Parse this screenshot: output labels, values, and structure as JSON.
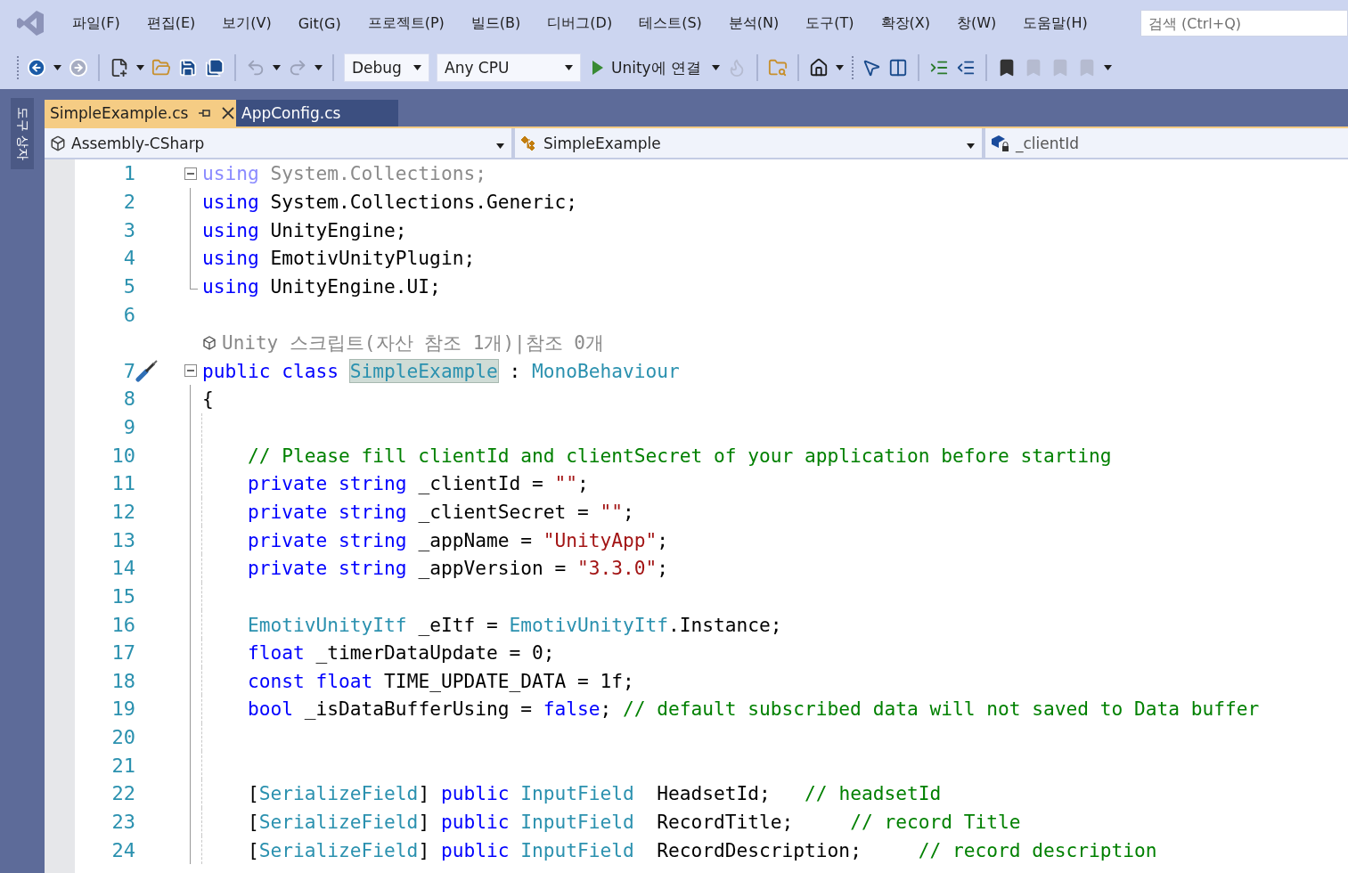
{
  "menu": {
    "items": [
      "파일(F)",
      "편집(E)",
      "보기(V)",
      "Git(G)",
      "프로젝트(P)",
      "빌드(B)",
      "디버그(D)",
      "테스트(S)",
      "분석(N)",
      "도구(T)",
      "확장(X)",
      "창(W)",
      "도움말(H)"
    ],
    "search": {
      "placeholder": "검색 (Ctrl+Q)"
    }
  },
  "toolbar": {
    "configuration": "Debug",
    "platform": "Any CPU",
    "run": "Unity에 연결"
  },
  "side_strip": {
    "label": "도구 상자"
  },
  "tabs": [
    {
      "label": "SimpleExample.cs",
      "selected": true
    },
    {
      "label": "AppConfig.cs",
      "selected": false
    }
  ],
  "nav_bar": {
    "project": "Assembly-CSharp",
    "type": "SimpleExample",
    "member": "_clientId"
  },
  "code": [
    {
      "kind": "code",
      "number": "1",
      "expanded": true,
      "tokens": [
        {
          "kind": "faded_keyword",
          "text": "using"
        },
        {
          "kind": "faded",
          "text": " System.Collections;"
        }
      ],
      "children": [
        {
          "kind": "code",
          "number": "2",
          "tokens": [
            {
              "kind": "keyword",
              "text": "using"
            },
            {
              "kind": "plain",
              "text": " System.Collections.Generic;"
            }
          ]
        },
        {
          "kind": "code",
          "number": "3",
          "tokens": [
            {
              "kind": "keyword",
              "text": "using"
            },
            {
              "kind": "plain",
              "text": " UnityEngine;"
            }
          ]
        },
        {
          "kind": "code",
          "number": "4",
          "tokens": [
            {
              "kind": "keyword",
              "text": "using"
            },
            {
              "kind": "plain",
              "text": " EmotivUnityPlugin;"
            }
          ]
        },
        {
          "kind": "code",
          "number": "5",
          "tokens": [
            {
              "kind": "keyword",
              "text": "using"
            },
            {
              "kind": "plain",
              "text": " UnityEngine.UI;"
            }
          ]
        }
      ]
    },
    {
      "kind": "code",
      "number": "6"
    },
    {
      "kind": "lens",
      "text": "Unity 스크립트(자산 참조 1개)|참조 0개"
    },
    {
      "kind": "code",
      "number": "7",
      "expanded": true,
      "glyph": true,
      "tokens": [
        {
          "kind": "keyword",
          "text": "public class "
        },
        {
          "kind": "highlight",
          "text": "SimpleExample"
        },
        {
          "kind": "plain",
          "text": " : "
        },
        {
          "kind": "type",
          "text": "MonoBehaviour"
        }
      ],
      "children": [
        {
          "kind": "code",
          "number": "8",
          "tokens": [
            {
              "kind": "plain",
              "text": "{"
            }
          ]
        },
        {
          "kind": "code",
          "number": "9"
        },
        {
          "kind": "code",
          "number": "10",
          "tokens": [
            {
              "kind": "comment",
              "text": "    // Please fill clientId and clientSecret of your application before starting"
            }
          ]
        },
        {
          "kind": "code",
          "number": "11",
          "tokens": [
            {
              "kind": "keyword",
              "text": "    private string"
            },
            {
              "kind": "plain",
              "text": " _clientId = "
            },
            {
              "kind": "string",
              "text": "\"\""
            },
            {
              "kind": "plain",
              "text": ";"
            }
          ]
        },
        {
          "kind": "code",
          "number": "12",
          "tokens": [
            {
              "kind": "keyword",
              "text": "    private string"
            },
            {
              "kind": "plain",
              "text": " _clientSecret = "
            },
            {
              "kind": "string",
              "text": "\"\""
            },
            {
              "kind": "plain",
              "text": ";"
            }
          ]
        },
        {
          "kind": "code",
          "number": "13",
          "tokens": [
            {
              "kind": "keyword",
              "text": "    private string"
            },
            {
              "kind": "plain",
              "text": " _appName = "
            },
            {
              "kind": "string",
              "text": "\"UnityApp\""
            },
            {
              "kind": "plain",
              "text": ";"
            }
          ]
        },
        {
          "kind": "code",
          "number": "14",
          "tokens": [
            {
              "kind": "keyword",
              "text": "    private string"
            },
            {
              "kind": "plain",
              "text": " _appVersion = "
            },
            {
              "kind": "string",
              "text": "\"3.3.0\""
            },
            {
              "kind": "plain",
              "text": ";"
            }
          ]
        },
        {
          "kind": "code",
          "number": "15"
        },
        {
          "kind": "code",
          "number": "16",
          "tokens": [
            {
              "kind": "type",
              "text": "    EmotivUnityItf"
            },
            {
              "kind": "plain",
              "text": " _eItf = "
            },
            {
              "kind": "type",
              "text": "EmotivUnityItf"
            },
            {
              "kind": "plain",
              "text": ".Instance;"
            }
          ]
        },
        {
          "kind": "code",
          "number": "17",
          "tokens": [
            {
              "kind": "keyword",
              "text": "    float"
            },
            {
              "kind": "plain",
              "text": " _timerDataUpdate = 0;"
            }
          ]
        },
        {
          "kind": "code",
          "number": "18",
          "tokens": [
            {
              "kind": "keyword",
              "text": "    const float"
            },
            {
              "kind": "plain",
              "text": " TIME_UPDATE_DATA = 1f;"
            }
          ]
        },
        {
          "kind": "code",
          "number": "19",
          "tokens": [
            {
              "kind": "keyword",
              "text": "    bool"
            },
            {
              "kind": "plain",
              "text": " _isDataBufferUsing = "
            },
            {
              "kind": "keyword",
              "text": "false"
            },
            {
              "kind": "plain",
              "text": "; "
            },
            {
              "kind": "comment",
              "text": "// default subscribed data will not saved to Data buffer"
            }
          ]
        },
        {
          "kind": "code",
          "number": "20"
        },
        {
          "kind": "code",
          "number": "21"
        },
        {
          "kind": "code",
          "number": "22",
          "tokens": [
            {
              "kind": "plain",
              "text": "    ["
            },
            {
              "kind": "type",
              "text": "SerializeField"
            },
            {
              "kind": "plain",
              "text": "] "
            },
            {
              "kind": "keyword",
              "text": "public "
            },
            {
              "kind": "type",
              "text": "InputField"
            },
            {
              "kind": "plain",
              "text": "  HeadsetId;   "
            },
            {
              "kind": "comment",
              "text": "// headsetId"
            }
          ]
        },
        {
          "kind": "code",
          "number": "23",
          "tokens": [
            {
              "kind": "plain",
              "text": "    ["
            },
            {
              "kind": "type",
              "text": "SerializeField"
            },
            {
              "kind": "plain",
              "text": "] "
            },
            {
              "kind": "keyword",
              "text": "public "
            },
            {
              "kind": "type",
              "text": "InputField"
            },
            {
              "kind": "plain",
              "text": "  RecordTitle;     "
            },
            {
              "kind": "comment",
              "text": "// record Title"
            }
          ]
        },
        {
          "kind": "code",
          "number": "24",
          "tokens": [
            {
              "kind": "plain",
              "text": "    ["
            },
            {
              "kind": "type",
              "text": "SerializeField"
            },
            {
              "kind": "plain",
              "text": "] "
            },
            {
              "kind": "keyword",
              "text": "public "
            },
            {
              "kind": "type",
              "text": "InputField"
            },
            {
              "kind": "plain",
              "text": "  RecordDescription;     "
            },
            {
              "kind": "comment",
              "text": "// record description"
            }
          ]
        }
      ]
    }
  ]
}
